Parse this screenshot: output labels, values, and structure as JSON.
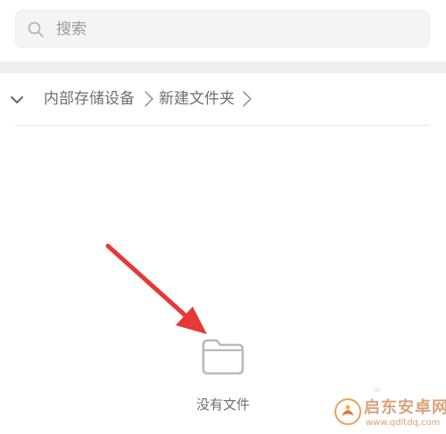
{
  "search": {
    "placeholder": "搜索",
    "icon": "search-icon"
  },
  "breadcrumb": {
    "toggle_icon": "chevron-down-icon",
    "items": [
      "内部存储设备",
      "新建文件夹"
    ],
    "separator_icon": "chevron-right-icon"
  },
  "empty_state": {
    "icon": "folder-icon",
    "label": "没有文件"
  },
  "annotation": {
    "arrow_color": "#e53935"
  },
  "watermark": {
    "title": "启东安卓网",
    "url": "www.qdltdq.com"
  },
  "colors": {
    "accent": "#e53935",
    "text_secondary": "#6f6f6f",
    "search_bg": "#f4f4f4",
    "watermark": "#d9a47a"
  }
}
